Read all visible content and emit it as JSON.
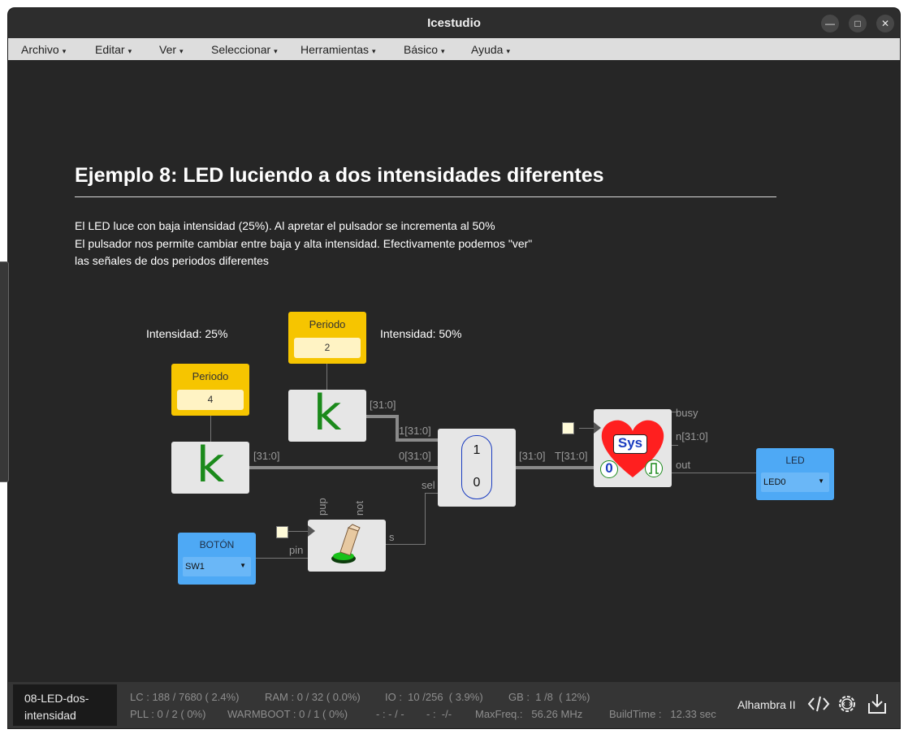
{
  "window": {
    "title": "Icestudio"
  },
  "menu": {
    "items": [
      {
        "label": "Archivo",
        "caret": "▾"
      },
      {
        "label": "Editar",
        "caret": "▾"
      },
      {
        "label": "Ver",
        "caret": "▾"
      },
      {
        "label": "Seleccionar",
        "caret": "▾"
      },
      {
        "label": "Herramientas",
        "caret": "▾"
      },
      {
        "label": "Básico",
        "caret": "▾"
      },
      {
        "label": "Ayuda",
        "caret": "▾"
      }
    ]
  },
  "doc": {
    "heading": "Ejemplo 8: LED luciendo a dos intensidades diferentes",
    "lines": [
      "El LED luce con baja intensidad (25%). Al apretar el pulsador se incrementa al 50%",
      "El pulsador nos permite cambiar entre baja y alta intensidad. Efectivamente podemos \"ver\"",
      "las señales de dos periodos diferentes"
    ],
    "note_low": "Intensidad: 25%",
    "note_high": "Intensidad: 50%"
  },
  "circuit": {
    "param_low": {
      "label": "Periodo",
      "value": "4"
    },
    "param_high": {
      "label": "Periodo",
      "value": "2"
    },
    "const_glyph": "k",
    "bus_31_0": "[31:0]",
    "mux": {
      "in1": "1[31:0]",
      "in0": "0[31:0]",
      "sel": "sel",
      "top": "1",
      "bottom": "0",
      "out": "[31:0]"
    },
    "button": {
      "pup": "pup",
      "not": "not",
      "pin": "pin",
      "s": "s"
    },
    "boton": {
      "label": "BOTÓN",
      "value": "SW1"
    },
    "sys": {
      "in_t": "T[31:0]",
      "busy": "busy",
      "n": "n[31:0]",
      "out": "out",
      "text": "Sys",
      "zero": "0"
    },
    "led": {
      "label": "LED",
      "value": "LED0"
    }
  },
  "status": {
    "filename_line1": "08-LED-dos-",
    "filename_line2": "intensidad",
    "lc": "LC : 188 / 7680 ( 2.4%)",
    "ram": "RAM : 0 / 32 ( 0.0%)",
    "io": "IO :  10 /256  ( 3.9%)",
    "gb": "GB :  1 /8  ( 12%)",
    "pll": "PLL : 0 / 2 ( 0%)",
    "warmboot": "WARMBOOT : 0 / 1 ( 0%)",
    "dash1": "- : - / -",
    "dash2": "- :  -/-",
    "maxfreq": "MaxFreq.:   56.26 MHz",
    "buildtime": "BuildTime :   12.33 sec",
    "board": "Alhambra II"
  },
  "colors": {
    "param_yellow": "#f6c500",
    "io_blue": "#4ea9f5",
    "const_green": "#1b8a1b",
    "mux_border": "#1a3cc0",
    "heart_red": "#ff1f1f"
  }
}
